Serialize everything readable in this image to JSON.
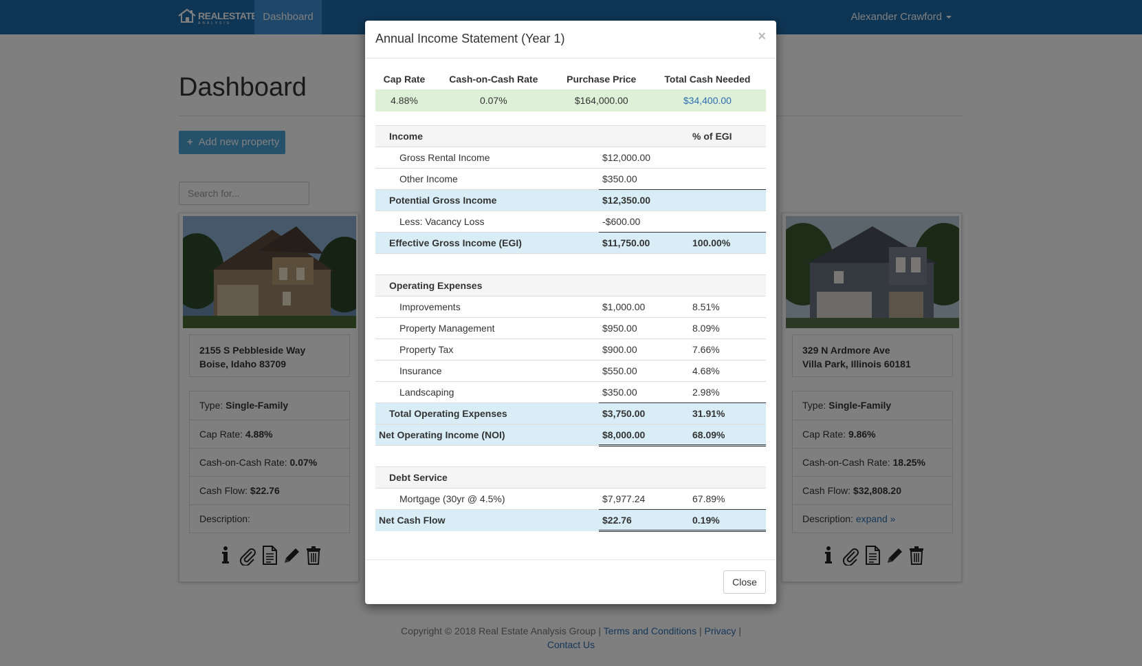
{
  "navbar": {
    "brand_main": "REALESTATE",
    "brand_sub": "ANALYSIS",
    "active_tab": "Dashboard",
    "user": "Alexander Crawford"
  },
  "page": {
    "title": "Dashboard",
    "add_button": "Add new property",
    "search_placeholder": "Search for..."
  },
  "cards": [
    {
      "address_line1": "2155 S Pebbleside Way",
      "address_line2": "Boise, Idaho 83709",
      "type_label": "Type:",
      "type_value": "Single-Family",
      "cap_label": "Cap Rate:",
      "cap_value": "4.88%",
      "coc_label": "Cash-on-Cash Rate:",
      "coc_value": "0.07%",
      "cf_label": "Cash Flow:",
      "cf_value": "$22.76",
      "desc_label": "Description:",
      "desc_value": ""
    },
    {
      "address_line1": "329 N Ardmore Ave",
      "address_line2": "Villa Park, Illinois 60181",
      "type_label": "Type:",
      "type_value": "Single-Family",
      "cap_label": "Cap Rate:",
      "cap_value": "9.86%",
      "coc_label": "Cash-on-Cash Rate:",
      "coc_value": "18.25%",
      "cf_label": "Cash Flow:",
      "cf_value": "$32,808.20",
      "desc_label": "Description:",
      "desc_value": "expand »"
    }
  ],
  "icons": [
    "info-icon",
    "paperclip-icon",
    "document-icon",
    "pencil-icon",
    "trash-icon",
    "house-logo-icon",
    "caret-down-icon",
    "plus-icon"
  ],
  "colors": {
    "navbar": "#1f6aa8",
    "nav_active": "#3f8ed2",
    "add_button": "#4aa3d6",
    "summary_row": "#dff0d8",
    "total_row": "#d9edf7",
    "link": "#2a6fb3"
  },
  "modal": {
    "title": "Annual Income Statement (Year 1)",
    "close_x": "×",
    "close_button": "Close",
    "summary": {
      "headers": [
        "Cap Rate",
        "Cash-on-Cash Rate",
        "Purchase Price",
        "Total Cash Needed"
      ],
      "values": [
        "4.88%",
        "0.07%",
        "$164,000.00",
        "$34,400.00"
      ]
    },
    "income": {
      "header": "Income",
      "pct_header": "% of EGI",
      "gross_rental": {
        "label": "Gross Rental Income",
        "amount": "$12,000.00"
      },
      "other": {
        "label": "Other Income",
        "amount": "$350.00"
      },
      "pgi": {
        "label": "Potential Gross Income",
        "amount": "$12,350.00"
      },
      "vacancy": {
        "label": "Less: Vacancy Loss",
        "amount": "-$600.00"
      },
      "egi": {
        "label": "Effective Gross Income (EGI)",
        "amount": "$11,750.00",
        "pct": "100.00%"
      }
    },
    "expenses": {
      "header": "Operating Expenses",
      "items": [
        {
          "label": "Improvements",
          "amount": "$1,000.00",
          "pct": "8.51%"
        },
        {
          "label": "Property Management",
          "amount": "$950.00",
          "pct": "8.09%"
        },
        {
          "label": "Property Tax",
          "amount": "$900.00",
          "pct": "7.66%"
        },
        {
          "label": "Insurance",
          "amount": "$550.00",
          "pct": "4.68%"
        },
        {
          "label": "Landscaping",
          "amount": "$350.00",
          "pct": "2.98%"
        }
      ],
      "total": {
        "label": "Total Operating Expenses",
        "amount": "$3,750.00",
        "pct": "31.91%"
      },
      "noi": {
        "label": "Net Operating Income (NOI)",
        "amount": "$8,000.00",
        "pct": "68.09%"
      }
    },
    "debt": {
      "header": "Debt Service",
      "mortgage": {
        "label": "Mortgage (30yr @ 4.5%)",
        "amount": "$7,977.24",
        "pct": "67.89%"
      },
      "net_cash_flow": {
        "label": "Net Cash Flow",
        "amount": "$22.76",
        "pct": "0.19%"
      }
    }
  },
  "footer": {
    "copyright": "Copyright © 2018 Real Estate Analysis Group |",
    "terms": "Terms and Conditions",
    "sep1": "|",
    "privacy": "Privacy",
    "sep2": "|",
    "contact": "Contact Us"
  }
}
